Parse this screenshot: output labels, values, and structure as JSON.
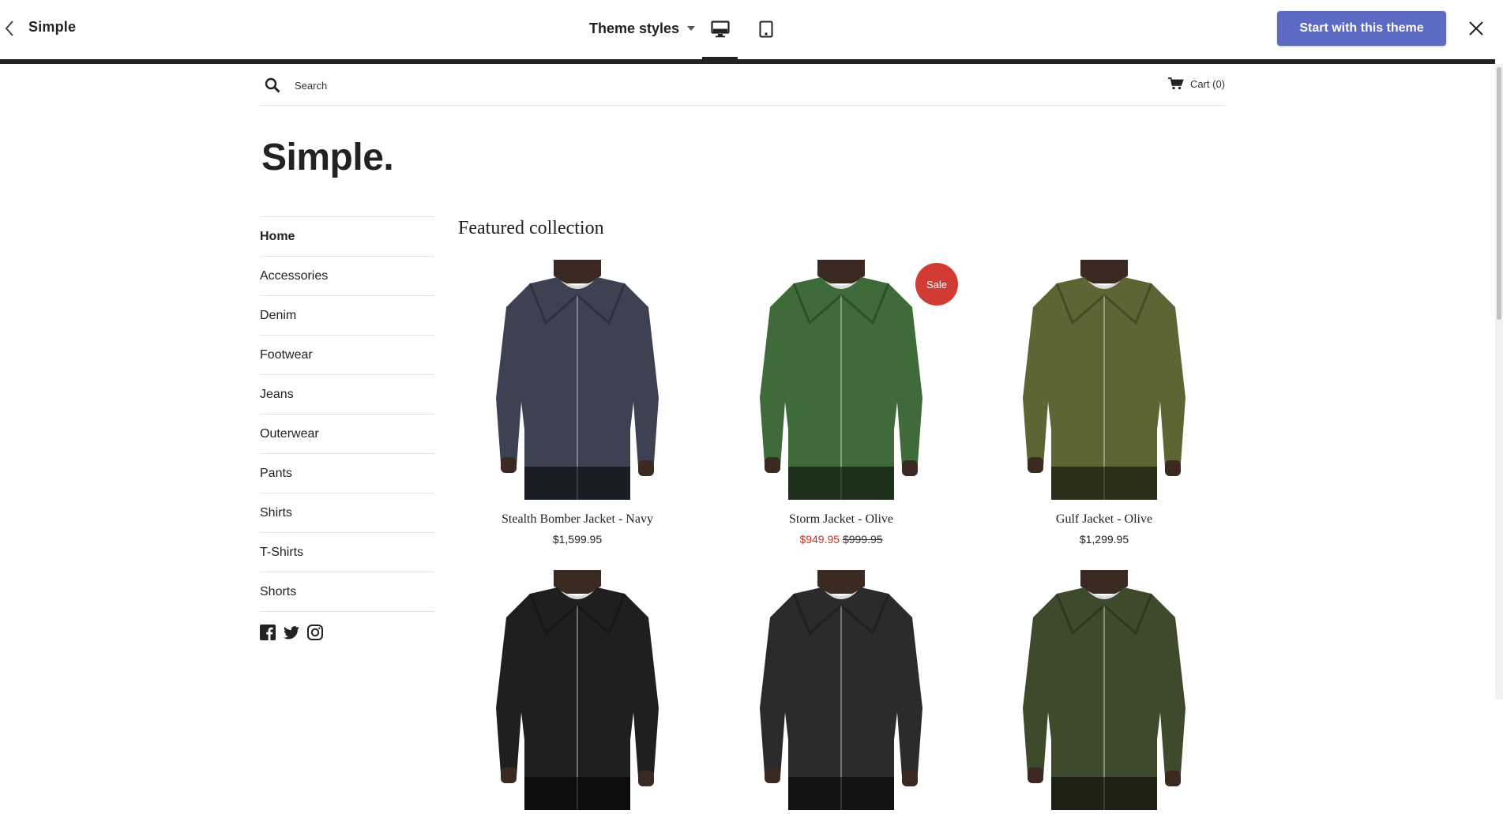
{
  "topbar": {
    "theme_name": "Simple",
    "styles_label": "Theme styles",
    "cta_label": "Start with this theme"
  },
  "store": {
    "search_placeholder": "Search",
    "cart_label": "Cart (0)",
    "logo": "Simple.",
    "nav": [
      "Home",
      "Accessories",
      "Denim",
      "Footwear",
      "Jeans",
      "Outerwear",
      "Pants",
      "Shirts",
      "T-Shirts",
      "Shorts"
    ],
    "active_nav": "Home",
    "social_icons": [
      "facebook-icon",
      "twitter-icon",
      "instagram-icon"
    ],
    "section_title": "Featured collection",
    "sale_badge": "Sale",
    "products": [
      {
        "name": "Stealth Bomber Jacket - Navy",
        "price": "$1,599.95",
        "sale_price": "",
        "jacket_color": "#3d4152",
        "skin": "#3b2a22"
      },
      {
        "name": "Storm Jacket - Olive",
        "price": "$999.95",
        "sale_price": "$949.95",
        "jacket_color": "#3f6a3a",
        "skin": "#3b2a22"
      },
      {
        "name": "Gulf Jacket - Olive",
        "price": "$1,299.95",
        "sale_price": "",
        "jacket_color": "#5f6435",
        "skin": "#3b2a22"
      },
      {
        "name": "",
        "price": "",
        "sale_price": "",
        "jacket_color": "#1f1f1f",
        "skin": "#3b2a22"
      },
      {
        "name": "",
        "price": "",
        "sale_price": "",
        "jacket_color": "#2b2b2e",
        "skin": "#3b2a22"
      },
      {
        "name": "",
        "price": "",
        "sale_price": "",
        "jacket_color": "#3e4a2c",
        "skin": "#3b2a22"
      }
    ]
  },
  "colors": {
    "accent": "#5c6ac4",
    "sale_red": "#d23b34",
    "sale_price_red": "#d62d20",
    "border": "#e4e4e4"
  }
}
